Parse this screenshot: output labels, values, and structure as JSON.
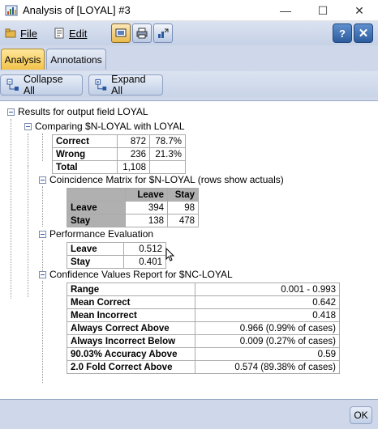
{
  "window": {
    "title": "Analysis of [LOYAL] #3",
    "min_glyph": "—",
    "max_glyph": "☐",
    "close_glyph": "✕"
  },
  "toolbar": {
    "file_label": "File",
    "edit_label": "Edit",
    "icons": [
      "display-icon",
      "print-icon",
      "export-icon"
    ],
    "help_glyph": "?",
    "close_glyph": "✕"
  },
  "tabs": [
    {
      "label": "Analysis",
      "active": true
    },
    {
      "label": "Annotations",
      "active": false
    }
  ],
  "actions": {
    "collapse_label": "Collapse All",
    "expand_label": "Expand All"
  },
  "tree": {
    "root_label": "Results for output field LOYAL",
    "comparing": {
      "label": "Comparing $N-LOYAL with LOYAL",
      "rows": [
        {
          "label": "Correct",
          "count": "872",
          "pct": "78.7%"
        },
        {
          "label": "Wrong",
          "count": "236",
          "pct": "21.3%"
        },
        {
          "label": "Total",
          "count": "1,108",
          "pct": ""
        }
      ]
    },
    "coincidence": {
      "label": "Coincidence Matrix for $N-LOYAL (rows show actuals)",
      "cols": [
        "Leave",
        "Stay"
      ],
      "rows": [
        {
          "label": "Leave",
          "values": [
            "394",
            "98"
          ]
        },
        {
          "label": "Stay",
          "values": [
            "138",
            "478"
          ]
        }
      ]
    },
    "performance": {
      "label": "Performance Evaluation",
      "rows": [
        {
          "label": "Leave",
          "value": "0.512"
        },
        {
          "label": "Stay",
          "value": "0.401"
        }
      ]
    },
    "confidence": {
      "label": "Confidence Values Report for $NC-LOYAL",
      "rows": [
        {
          "label": "Range",
          "value": "0.001 - 0.993"
        },
        {
          "label": "Mean Correct",
          "value": "0.642"
        },
        {
          "label": "Mean Incorrect",
          "value": "0.418"
        },
        {
          "label": "Always Correct Above",
          "value": "0.966 (0.99% of cases)"
        },
        {
          "label": "Always Incorrect Below",
          "value": "0.009 (0.27% of cases)"
        },
        {
          "label": "90.03% Accuracy Above",
          "value": "0.59"
        },
        {
          "label": "2.0 Fold Correct Above",
          "value": "0.574 (89.38% of cases)"
        }
      ]
    }
  },
  "footer": {
    "ok_label": "OK"
  },
  "colors": {
    "frame": "#cfd8ea",
    "active_tab": "#f2c24a",
    "matrix_header": "#b0b0b0"
  }
}
